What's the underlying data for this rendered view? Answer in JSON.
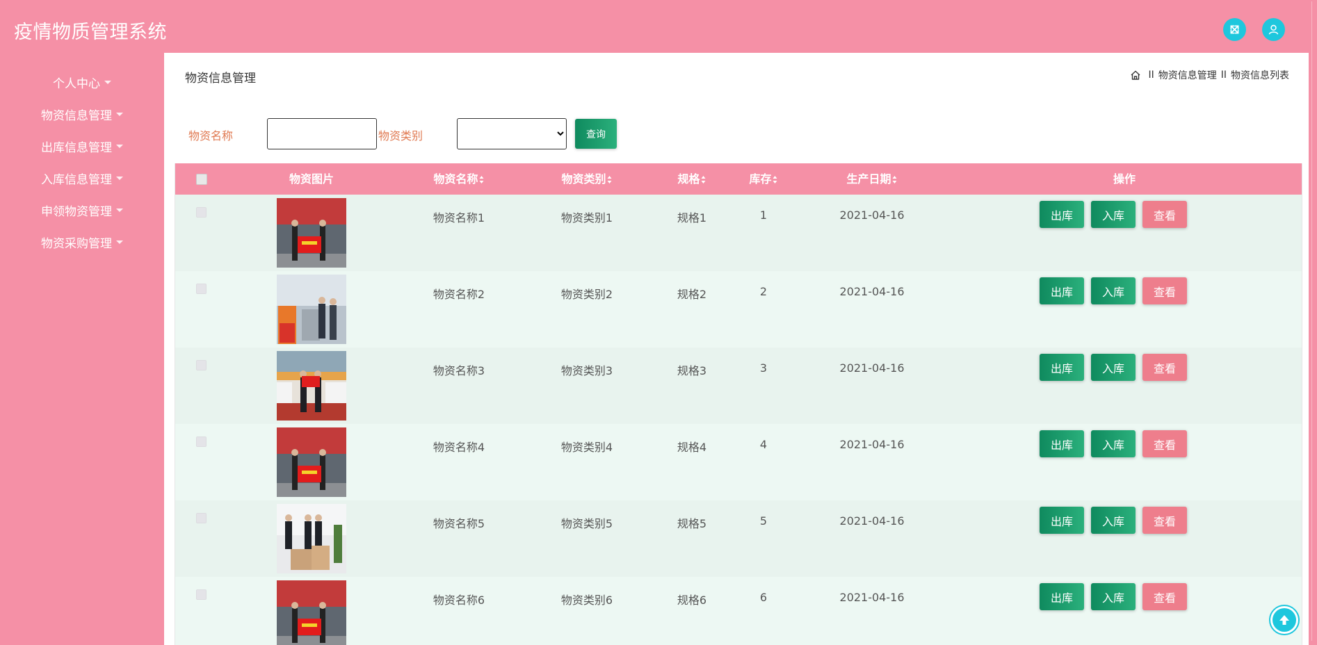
{
  "app": {
    "title": "疫情物质管理系统"
  },
  "header": {
    "fullscreen_icon": "expand-arrows-icon",
    "user_icon": "user-icon"
  },
  "sidebar": {
    "items": [
      {
        "label": "个人中心"
      },
      {
        "label": "物资信息管理"
      },
      {
        "label": "出库信息管理"
      },
      {
        "label": "入库信息管理"
      },
      {
        "label": "申领物资管理"
      },
      {
        "label": "物资采购管理"
      }
    ]
  },
  "page": {
    "heading": "物资信息管理",
    "breadcrumb": {
      "home_icon": "home-icon",
      "separator": "II",
      "items": [
        "物资信息管理",
        "物资信息列表"
      ]
    }
  },
  "search": {
    "name_label": "物资名称",
    "name_value": "",
    "category_label": "物资类别",
    "category_value": "",
    "query_label": "查询"
  },
  "table": {
    "headers": {
      "image": "物资图片",
      "name": "物资名称",
      "category": "物资类别",
      "spec": "规格",
      "stock": "库存",
      "date": "生产日期",
      "actions": "操作"
    },
    "rows": [
      {
        "name": "物资名称1",
        "category": "物资类别1",
        "spec": "规格1",
        "stock": "1",
        "date": "2021-04-16",
        "image": "photo-banner-truck"
      },
      {
        "name": "物资名称2",
        "category": "物资类别2",
        "spec": "规格2",
        "stock": "2",
        "date": "2021-04-16",
        "image": "photo-supplies-boxes"
      },
      {
        "name": "物资名称3",
        "category": "物资类别3",
        "spec": "规格3",
        "stock": "3",
        "date": "2021-04-16",
        "image": "photo-banner-sofa"
      },
      {
        "name": "物资名称4",
        "category": "物资类别4",
        "spec": "规格4",
        "stock": "4",
        "date": "2021-04-16",
        "image": "photo-banner-truck"
      },
      {
        "name": "物资名称5",
        "category": "物资类别5",
        "spec": "规格5",
        "stock": "5",
        "date": "2021-04-16",
        "image": "photo-people-boxes"
      },
      {
        "name": "物资名称6",
        "category": "物资类别6",
        "spec": "规格6",
        "stock": "6",
        "date": "2021-04-16",
        "image": "photo-banner-truck"
      }
    ],
    "actions": {
      "out": "出库",
      "in": "入库",
      "view": "查看"
    }
  },
  "colors": {
    "theme_pink": "#f590a6",
    "accent_green": "#1a9b6c",
    "view_button": "#ee7e8c",
    "icon_cyan": "#1ec7dd",
    "search_label": "#e07a52"
  },
  "back_to_top_icon": "arrow-up-circle-icon"
}
